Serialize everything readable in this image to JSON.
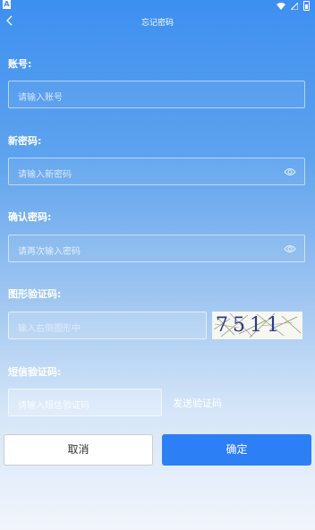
{
  "status_bar": {
    "left_badge": "A"
  },
  "header": {
    "title": "忘记密码"
  },
  "form": {
    "account": {
      "label": "账号:",
      "placeholder": "请输入账号"
    },
    "new_password": {
      "label": "新密码:",
      "placeholder": "请输入新密码"
    },
    "confirm_password": {
      "label": "确认密码:",
      "placeholder": "请再次输入密码"
    },
    "captcha": {
      "label": "图形验证码:",
      "placeholder": "输入右侧图形中",
      "image_text": "7511"
    },
    "sms_code": {
      "label": "短信验证码:",
      "placeholder": "请输入短信验证码",
      "send_label": "发送验证码"
    }
  },
  "buttons": {
    "cancel": "取消",
    "confirm": "确定"
  },
  "colors": {
    "primary": "#2d7ff5",
    "bg_top": "#3d8ff0",
    "bg_bottom": "#f1f5fb"
  }
}
